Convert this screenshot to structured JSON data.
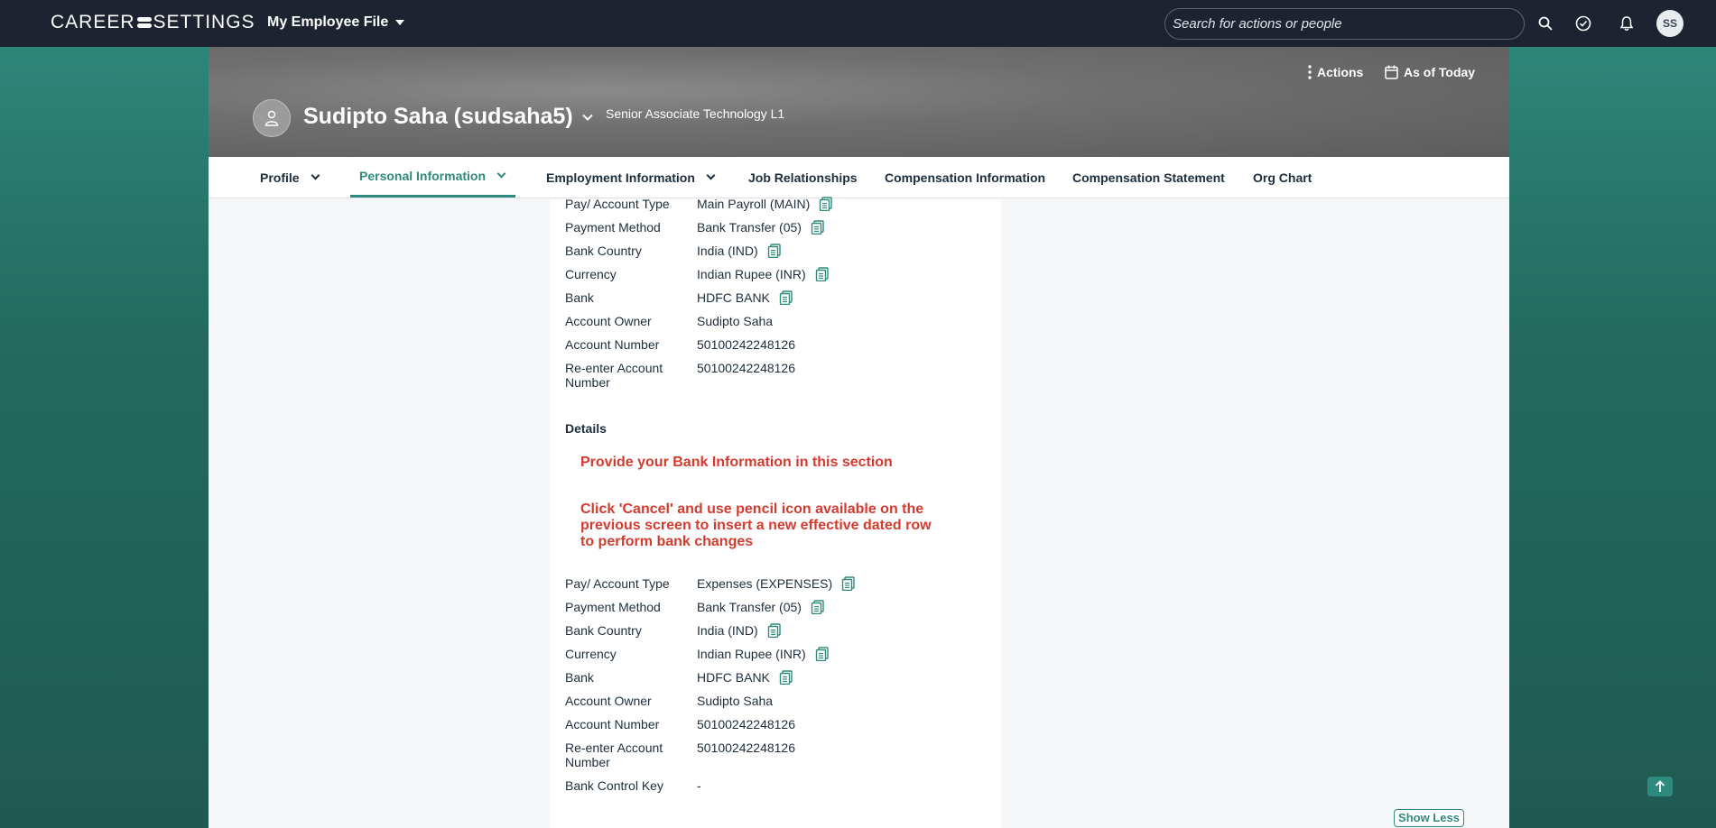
{
  "shell": {
    "logo_left": "CAREER",
    "logo_right": "SETTINGS",
    "app_menu": "My Employee File",
    "search_placeholder": "Search for actions or people",
    "avatar_initials": "SS"
  },
  "header": {
    "actions_label": "Actions",
    "date_label": "As of Today",
    "person_name": "Sudipto Saha (sudsaha5)",
    "person_title": "Senior Associate Technology L1"
  },
  "tabs": [
    {
      "label": "Profile"
    },
    {
      "label": "Personal Information"
    },
    {
      "label": "Employment Information"
    },
    {
      "label": "Job Relationships"
    },
    {
      "label": "Compensation Information"
    },
    {
      "label": "Compensation Statement"
    },
    {
      "label": "Org Chart"
    }
  ],
  "payment1": {
    "rows": [
      {
        "label": "Pay/ Account Type",
        "value": "Main Payroll (MAIN)"
      },
      {
        "label": "Payment Method",
        "value": "Bank Transfer (05)"
      },
      {
        "label": "Bank Country",
        "value": "India (IND)"
      },
      {
        "label": "Currency",
        "value": "Indian Rupee (INR)"
      },
      {
        "label": "Bank",
        "value": "HDFC BANK"
      },
      {
        "label": "Account Owner",
        "value": "Sudipto Saha"
      },
      {
        "label": "Account Number",
        "value": "50100242248126"
      },
      {
        "label": "Re-enter Account Number",
        "value": "50100242248126"
      }
    ]
  },
  "details": {
    "title": "Details",
    "notice1": "Provide your Bank Information in this section",
    "notice2": "Click 'Cancel' and use pencil icon available on the previous screen to insert a new effective dated row to perform bank changes"
  },
  "payment2": {
    "rows": [
      {
        "label": "Pay/ Account Type",
        "value": "Expenses (EXPENSES)"
      },
      {
        "label": "Payment Method",
        "value": "Bank Transfer (05)"
      },
      {
        "label": "Bank Country",
        "value": "India (IND)"
      },
      {
        "label": "Currency",
        "value": "Indian Rupee (INR)"
      },
      {
        "label": "Bank",
        "value": "HDFC BANK"
      },
      {
        "label": "Account Owner",
        "value": "Sudipto Saha"
      },
      {
        "label": "Account Number",
        "value": "50100242248126"
      },
      {
        "label": "Re-enter Account Number",
        "value": "50100242248126"
      },
      {
        "label": "Bank Control Key",
        "value": "-"
      }
    ]
  },
  "footer": {
    "show_less": "Show Less"
  },
  "colors": {
    "accent": "#2f8a7d",
    "notice": "#d43b2d",
    "shell": "#1d2330"
  }
}
